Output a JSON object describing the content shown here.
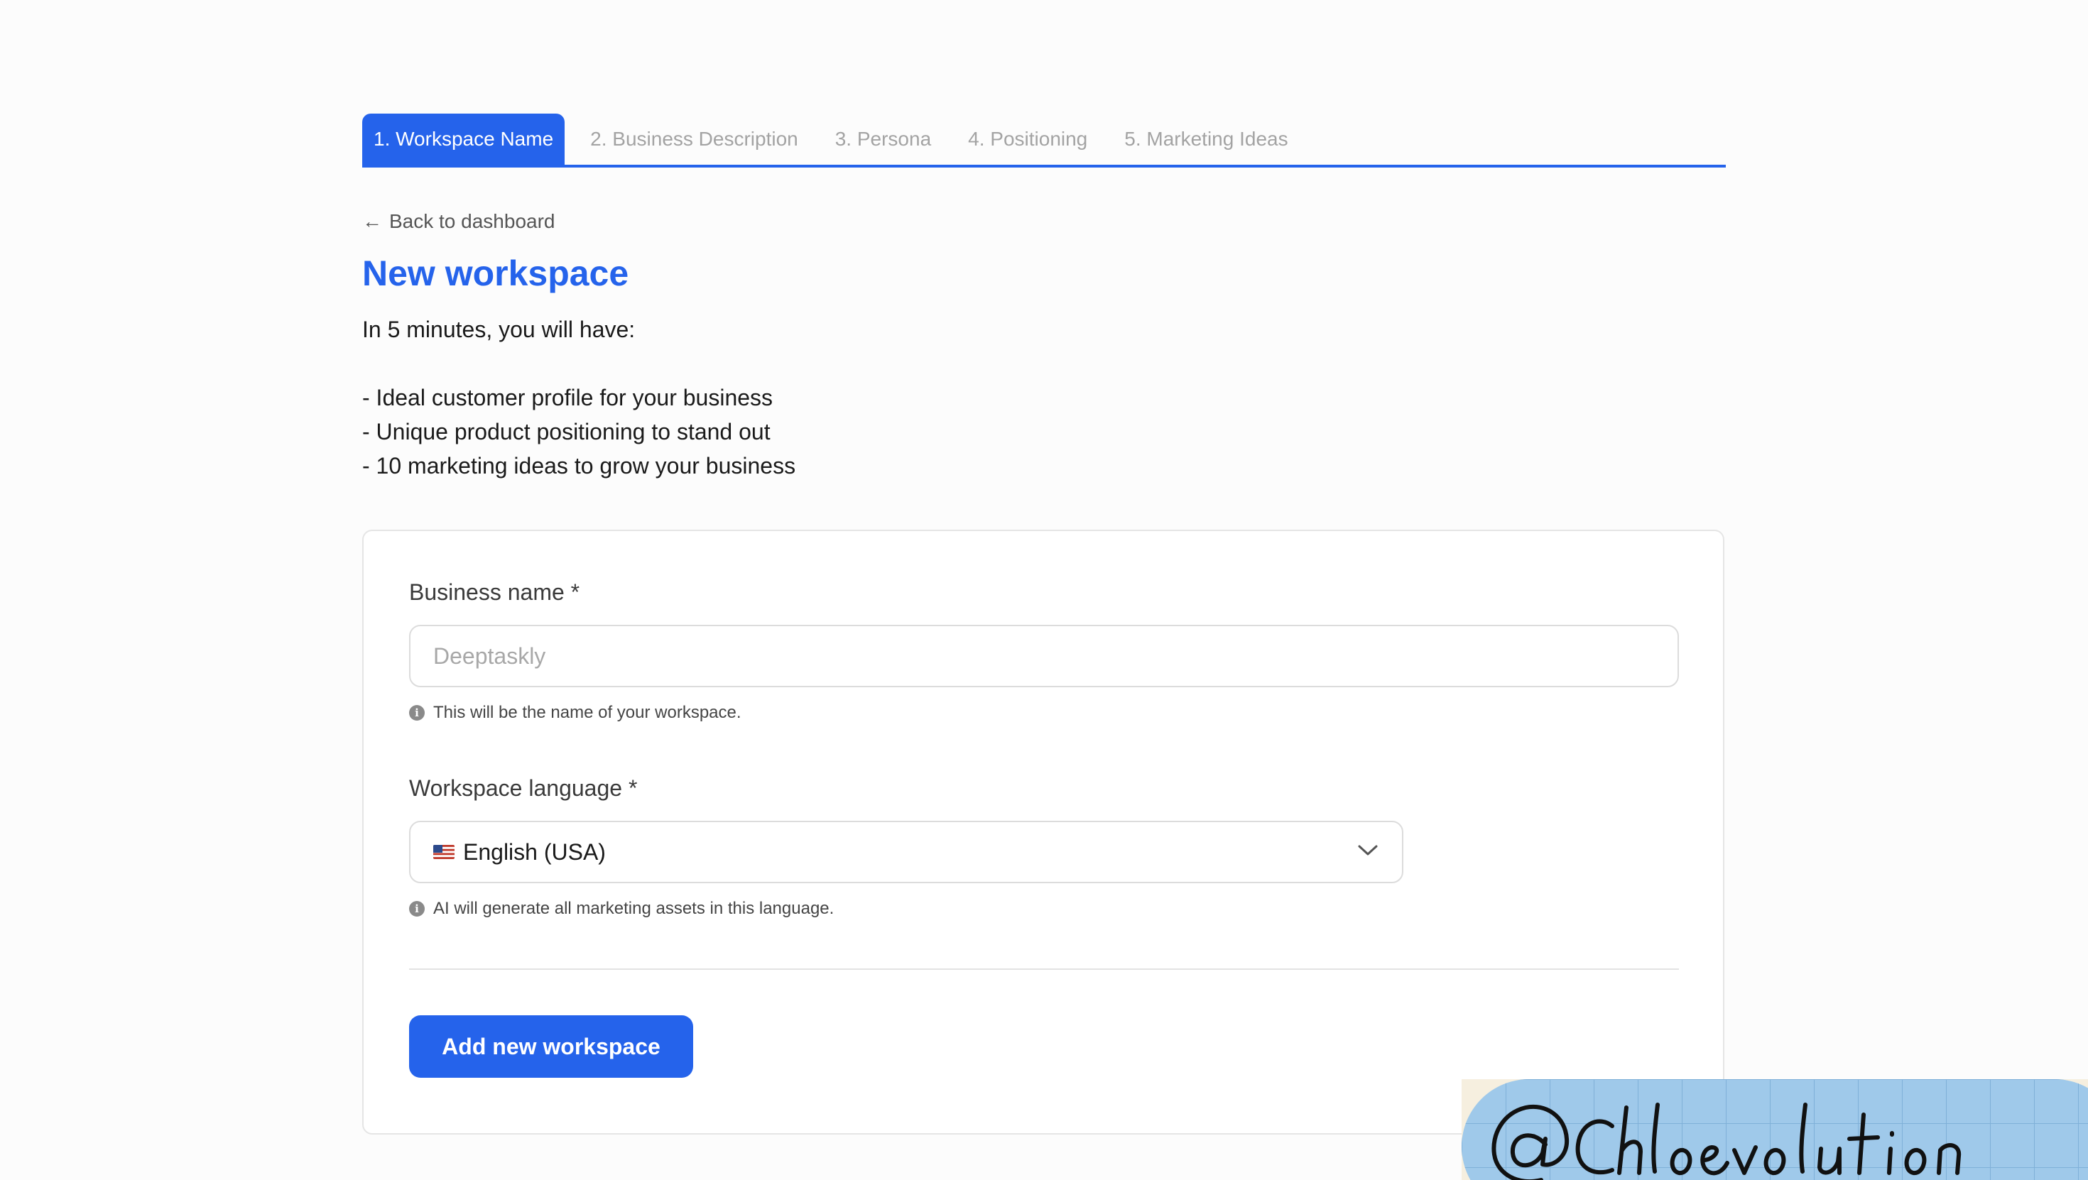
{
  "steps": [
    {
      "label": "1. Workspace Name",
      "active": true
    },
    {
      "label": "2. Business Description",
      "active": false
    },
    {
      "label": "3. Persona",
      "active": false
    },
    {
      "label": "4. Positioning",
      "active": false
    },
    {
      "label": "5. Marketing Ideas",
      "active": false
    }
  ],
  "header": {
    "back_arrow": "←",
    "back_label": "Back to dashboard",
    "title": "New workspace",
    "intro": "In 5 minutes, you will have:",
    "bullets": [
      "- Ideal customer profile for your business",
      "- Unique product positioning to stand out",
      "- 10 marketing ideas to grow your business"
    ]
  },
  "form": {
    "business_name": {
      "label": "Business name *",
      "placeholder": "Deeptaskly",
      "value": "",
      "hint": "This will be the name of your workspace."
    },
    "language": {
      "label": "Workspace language *",
      "flag_icon": "us-flag-icon",
      "selected": "English (USA)",
      "hint": "AI will generate all marketing assets in this language."
    },
    "submit_label": "Add new workspace"
  },
  "watermark": {
    "text": "@ Chloevolution",
    "colors": {
      "pill": "#9fc9ea",
      "grid": "#7fb0d8",
      "paper": "#f6efdf"
    }
  },
  "colors": {
    "accent": "#2563eb",
    "inactive_tab": "#a3a3a3",
    "border": "#dcdcdc"
  }
}
